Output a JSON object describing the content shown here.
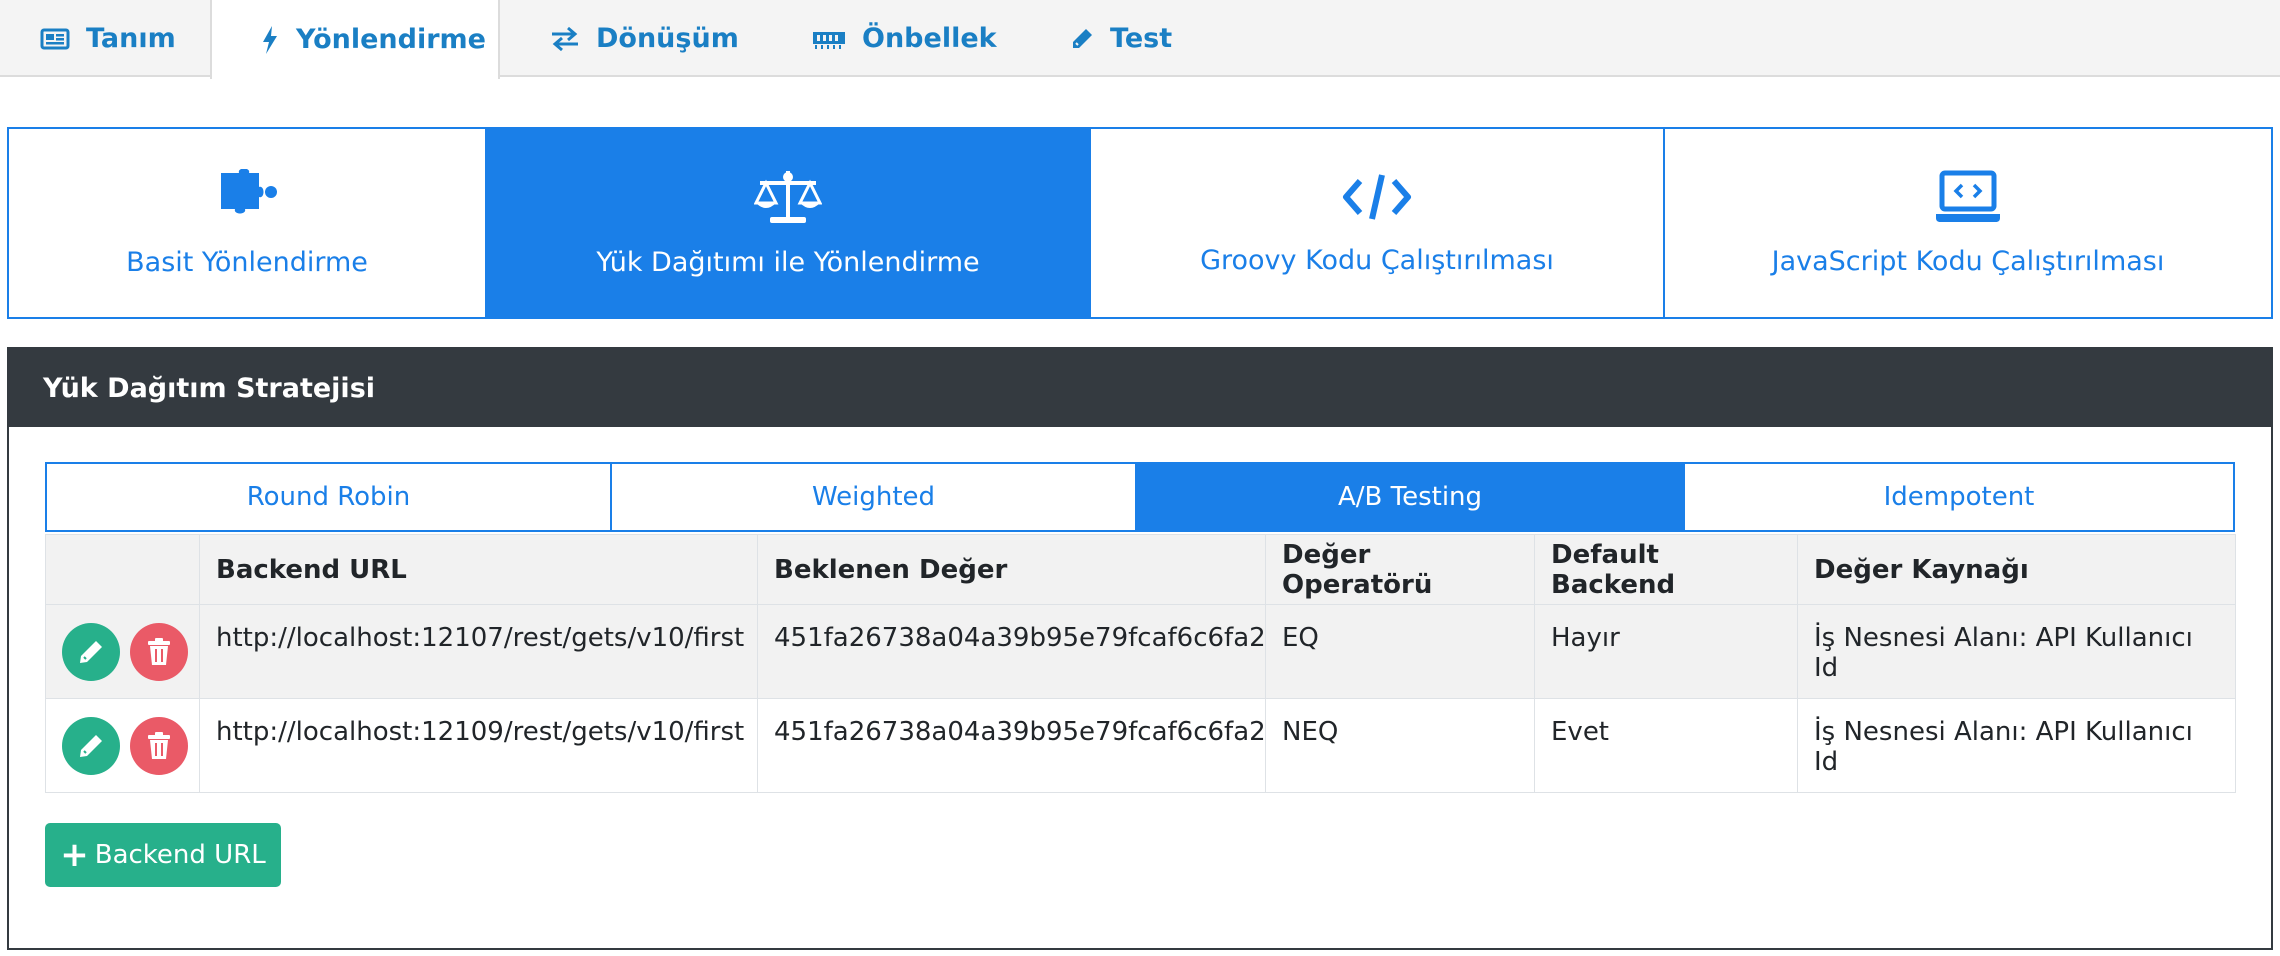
{
  "top_tabs": [
    {
      "label": "Tanım",
      "icon": "newspaper-icon"
    },
    {
      "label": "Yönlendirme",
      "icon": "bolt-icon",
      "active": true
    },
    {
      "label": "Dönüşüm",
      "icon": "exchange-icon"
    },
    {
      "label": "Önbellek",
      "icon": "memory-icon"
    },
    {
      "label": "Test",
      "icon": "pencil-icon"
    }
  ],
  "routing_methods": [
    {
      "label": "Basit Yönlendirme",
      "icon": "puzzle-icon"
    },
    {
      "label": "Yük Dağıtımı ile Yönlendirme",
      "icon": "balance-scale-icon",
      "active": true
    },
    {
      "label": "Groovy Kodu Çalıştırılması",
      "icon": "code-icon"
    },
    {
      "label": "JavaScript Kodu Çalıştırılması",
      "icon": "laptop-code-icon"
    }
  ],
  "panel": {
    "title": "Yük Dağıtım Stratejisi",
    "strategy_tabs": [
      {
        "label": "Round Robin"
      },
      {
        "label": "Weighted"
      },
      {
        "label": "A/B Testing",
        "active": true
      },
      {
        "label": "Idempotent"
      }
    ],
    "table": {
      "headers": [
        "",
        "Backend URL",
        "Beklenen Değer",
        "Değer Operatörü",
        "Default Backend",
        "Değer Kaynağı"
      ],
      "rows": [
        {
          "backend_url": "http://localhost:12107/rest/gets/v10/first",
          "expected_value": "451fa26738a04a39b95e79fcaf6c6fa2",
          "operator": "EQ",
          "default_backend": "Hayır",
          "value_source": "İş Nesnesi Alanı: API Kullanıcı Id"
        },
        {
          "backend_url": "http://localhost:12109/rest/gets/v10/first",
          "expected_value": "451fa26738a04a39b95e79fcaf6c6fa2",
          "operator": "NEQ",
          "default_backend": "Evet",
          "value_source": "İş Nesnesi Alanı: API Kullanıcı Id"
        }
      ]
    },
    "add_button_label": "Backend URL"
  },
  "colors": {
    "primary": "#1a7fe8",
    "tab_text": "#1a7fc4",
    "success": "#27b08b",
    "danger": "#ea5a67",
    "dark_header": "#343a40"
  }
}
